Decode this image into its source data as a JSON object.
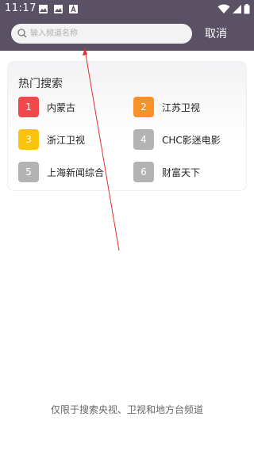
{
  "status": {
    "time": "11:17"
  },
  "search": {
    "placeholder": "输入频道名称",
    "cancel_label": "取消"
  },
  "hot": {
    "title": "热门搜索",
    "items": [
      {
        "rank": "1",
        "name": "内蒙古",
        "color": "#f2474b"
      },
      {
        "rank": "2",
        "name": "江苏卫视",
        "color": "#f7922b"
      },
      {
        "rank": "3",
        "name": "浙江卫视",
        "color": "#fbc30b"
      },
      {
        "rank": "4",
        "name": "CHC影迷电影",
        "color": "#b3b3b3"
      },
      {
        "rank": "5",
        "name": "上海新闻综合",
        "color": "#b3b3b3"
      },
      {
        "rank": "6",
        "name": "财富天下",
        "color": "#b3b3b3"
      }
    ]
  },
  "footer": {
    "note": "仅限于搜索央视、卫视和地方台频道"
  },
  "colors": {
    "header_bg": "#5a5165",
    "annotation_arrow": "#e03030"
  }
}
